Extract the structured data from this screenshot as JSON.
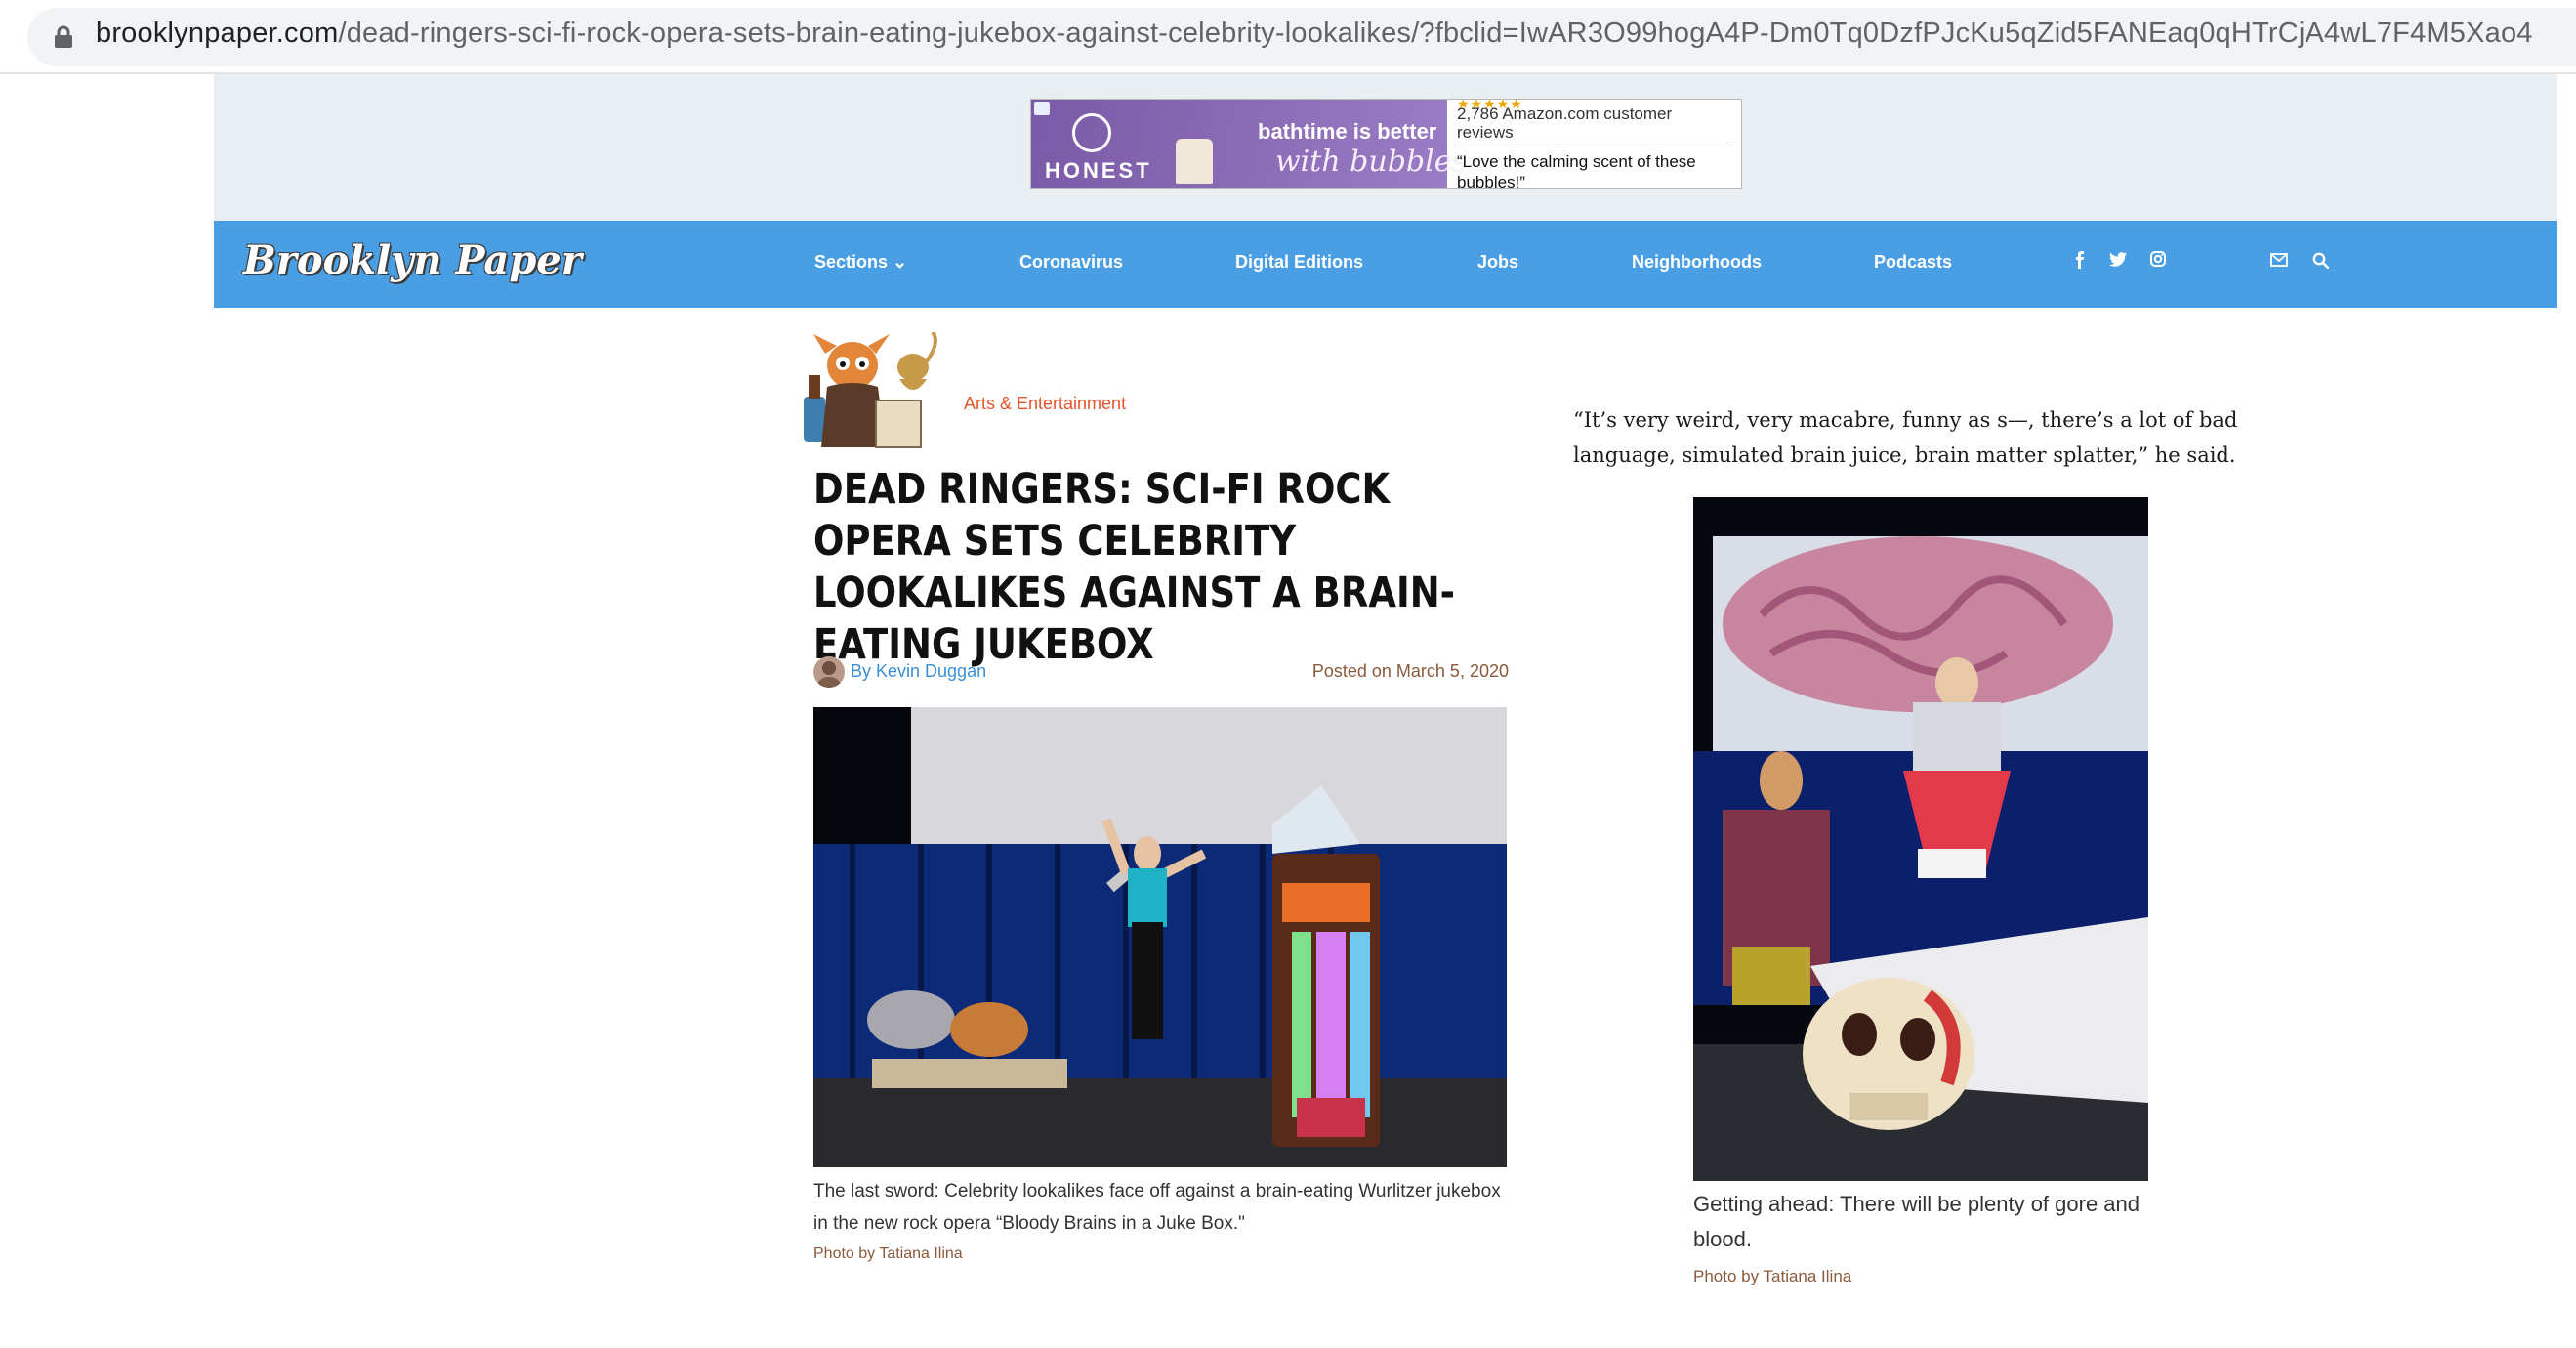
{
  "browser": {
    "url_host": "brooklynpaper.com",
    "url_path": "/dead-ringers-sci-fi-rock-opera-sets-brain-eating-jukebox-against-celebrity-lookalikes/?fbclid=IwAR3O99hogA4P-Dm0Tq0DzfPJcKu5qZid5FANEaq0qHTrCjA4wL7F4M5Xao4"
  },
  "ad": {
    "brand": "HONEST",
    "headline": "bathtime is better",
    "script": "with bubbles",
    "reviews": "2,786 Amazon.com customer reviews",
    "quote": "“Love the calming scent of these bubbles!”"
  },
  "header": {
    "logo": "Brooklyn Paper",
    "nav": [
      "Sections ⌄",
      "Coronavirus",
      "Digital Editions",
      "Jobs",
      "Neighborhoods",
      "Podcasts"
    ],
    "social_icons": [
      "facebook-icon",
      "twitter-icon",
      "instagram-icon"
    ],
    "util_icons": [
      "mail-icon",
      "search-icon"
    ]
  },
  "article": {
    "category": "Arts & Entertainment",
    "title": "DEAD RINGERS: SCI-FI ROCK OPERA SETS CELEBRITY LOOKALIKES AGAINST A BRAIN-EATING JUKEBOX",
    "byline": "By Kevin Duggan",
    "posted": "Posted on March 5, 2020",
    "caption1": "The last sword: Celebrity lookalikes face off against a brain-eating Wurlitzer jukebox in the new rock opera “Bloody Brains in a Juke Box.\"",
    "credit1": "Photo by Tatiana Ilina",
    "quote": "“It’s very weird, very macabre, funny as s—, there’s a lot of bad language, simulated brain juice, brain matter splatter,” he said.",
    "caption2": "Getting ahead: There will be plenty of gore and blood.",
    "credit2": "Photo by Tatiana Ilina"
  },
  "colors": {
    "header_blue": "#4a9ee3",
    "category_orange": "#e3552d",
    "byline_blue": "#3a8fd9",
    "credit_brown": "#8a5a3c"
  }
}
